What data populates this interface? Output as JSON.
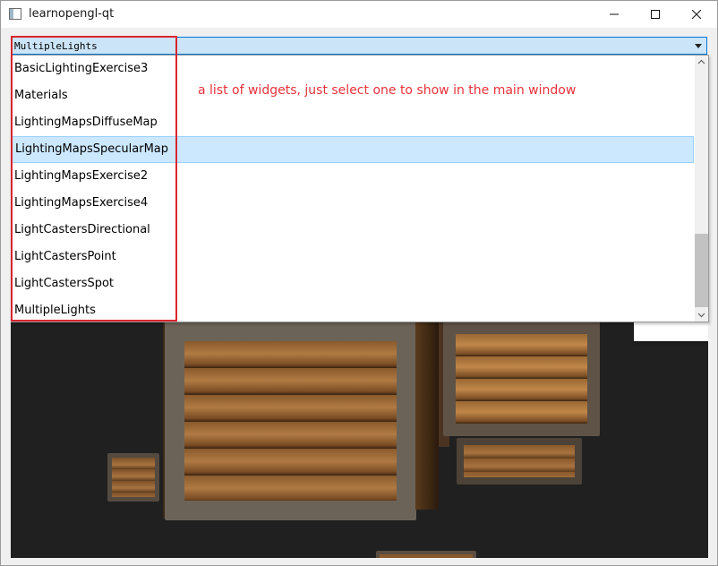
{
  "window": {
    "title": "learnopengl-qt",
    "icon": "window-icon",
    "controls": {
      "minimize": "minimize-icon",
      "maximize": "maximize-icon",
      "close": "close-icon"
    }
  },
  "combo": {
    "selected": "MultipleLights",
    "arrow_icon": "dropdown-arrow-icon"
  },
  "dropdown": {
    "items": [
      {
        "label": "BasicLightingExercise3"
      },
      {
        "label": "Materials"
      },
      {
        "label": "LightingMapsDiffuseMap"
      },
      {
        "label": "LightingMapsSpecularMap"
      },
      {
        "label": "LightingMapsExercise2"
      },
      {
        "label": "LightingMapsExercise4"
      },
      {
        "label": "LightCastersDirectional"
      },
      {
        "label": "LightCastersPoint"
      },
      {
        "label": "LightCastersSpot"
      },
      {
        "label": "MultipleLights"
      }
    ],
    "highlighted": "LightingMapsSpecularMap"
  },
  "annotation": {
    "text": "a list of widgets, just select one to show in the main window",
    "color": "#e8323a"
  },
  "colors": {
    "highlight": "#cce8ff",
    "combo_bg": "#cce4f7",
    "accent_border": "#0078d7"
  }
}
